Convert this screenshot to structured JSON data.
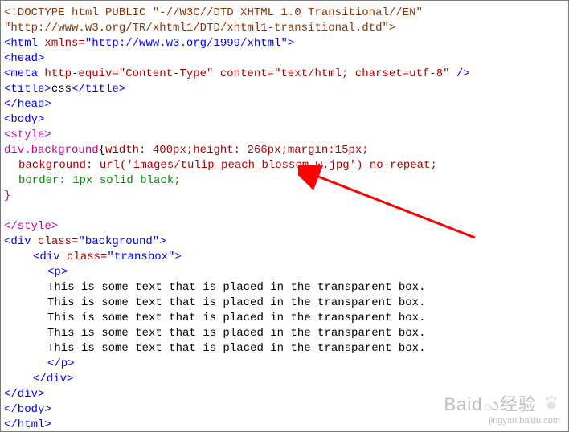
{
  "code": {
    "doctype1": "<!DOCTYPE html PUBLIC \"-//W3C//DTD XHTML 1.0 Transitional//EN\"",
    "doctype2": "\"http://www.w3.org/TR/xhtml1/DTD/xhtml1-transitional.dtd\">",
    "html_open_tag": "<html",
    "html_open_end": ">",
    "xmlns_attr": " xmlns=",
    "xmlns_val": "\"http://www.w3.org/1999/xhtml\"",
    "head_open": "<head>",
    "meta_open": "<meta",
    "meta_attrs": " http-equiv=\"Content-Type\" content=\"text/html; charset=utf-8\" ",
    "meta_close": "/>",
    "title_open": "<title>",
    "title_text": "css",
    "title_close": "</title>",
    "head_close": "</head>",
    "body_open": "<body>",
    "style_open": "<style>",
    "selector": "div.background",
    "brace_open": "{",
    "rule1": "width: 400px;height: 266px;margin:15px;",
    "rule2": "background: url('images/tulip_peach_blossom_w.jpg') no-repeat;",
    "rule3": "border: 1px solid black;",
    "brace_close": "}",
    "style_close": "</style>",
    "div_bg_open": "<div",
    "div_bg_close_tag": ">",
    "class_attr": " class=",
    "class_bg_val": "\"background\"",
    "div_trans_open": "<div",
    "class_trans_val": "\"transbox\"",
    "p_open": "<p>",
    "para": "This is some text that is placed in the transparent box.",
    "p_close": "</p>",
    "div_close": "</div>",
    "body_close": "</body>",
    "html_close": "</html>"
  },
  "watermark": {
    "brand": "Baidు经验",
    "url": "jingyan.baidu.com"
  }
}
